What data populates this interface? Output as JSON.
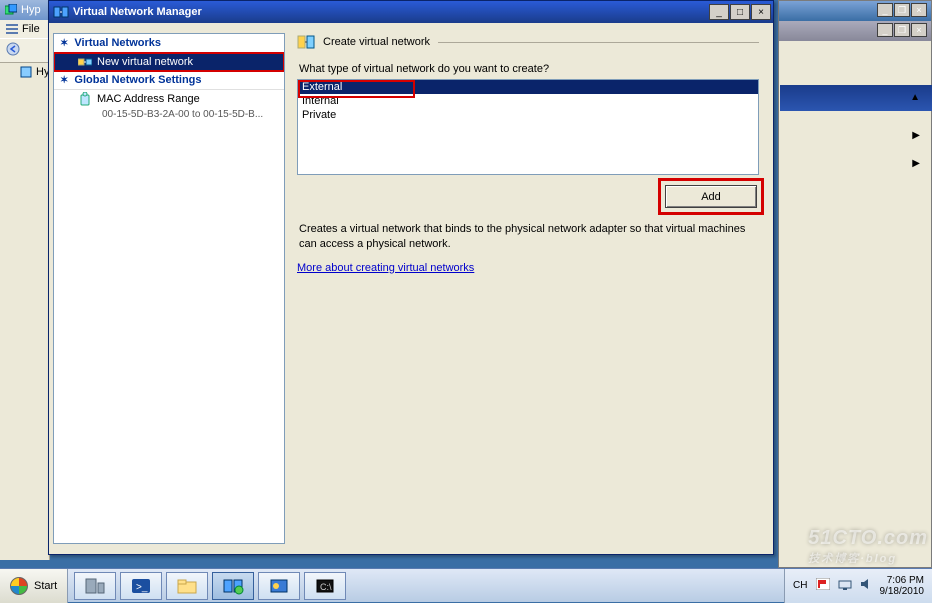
{
  "background": {
    "left_app_title": "Hyp",
    "menu_file": "File",
    "nav_root": "Hyp"
  },
  "right_bg": {
    "caret_up": "▲",
    "caret_right1": "▶",
    "caret_right2": "▶"
  },
  "window": {
    "title": "Virtual Network Manager",
    "min_glyph": "_",
    "max_glyph": "□",
    "close_glyph": "×"
  },
  "left_panel": {
    "section1": "Virtual Networks",
    "item_new": "New virtual network",
    "section2": "Global Network Settings",
    "item_mac": "MAC Address Range",
    "mac_range": "00-15-5D-B3-2A-00 to 00-15-5D-B..."
  },
  "right_panel": {
    "group_title": "Create virtual network",
    "prompt": "What type of virtual network do you want to create?",
    "options": [
      "External",
      "Internal",
      "Private"
    ],
    "add_button": "Add",
    "description": "Creates a virtual network that binds to the physical network adapter so that virtual machines can access a physical network.",
    "link": "More about creating virtual networks"
  },
  "taskbar": {
    "start": "Start",
    "lang": "CH",
    "time": "7:06 PM",
    "date": "9/18/2010"
  },
  "watermark": {
    "main": "51CTO.com",
    "sub": "技术博客·blog"
  }
}
